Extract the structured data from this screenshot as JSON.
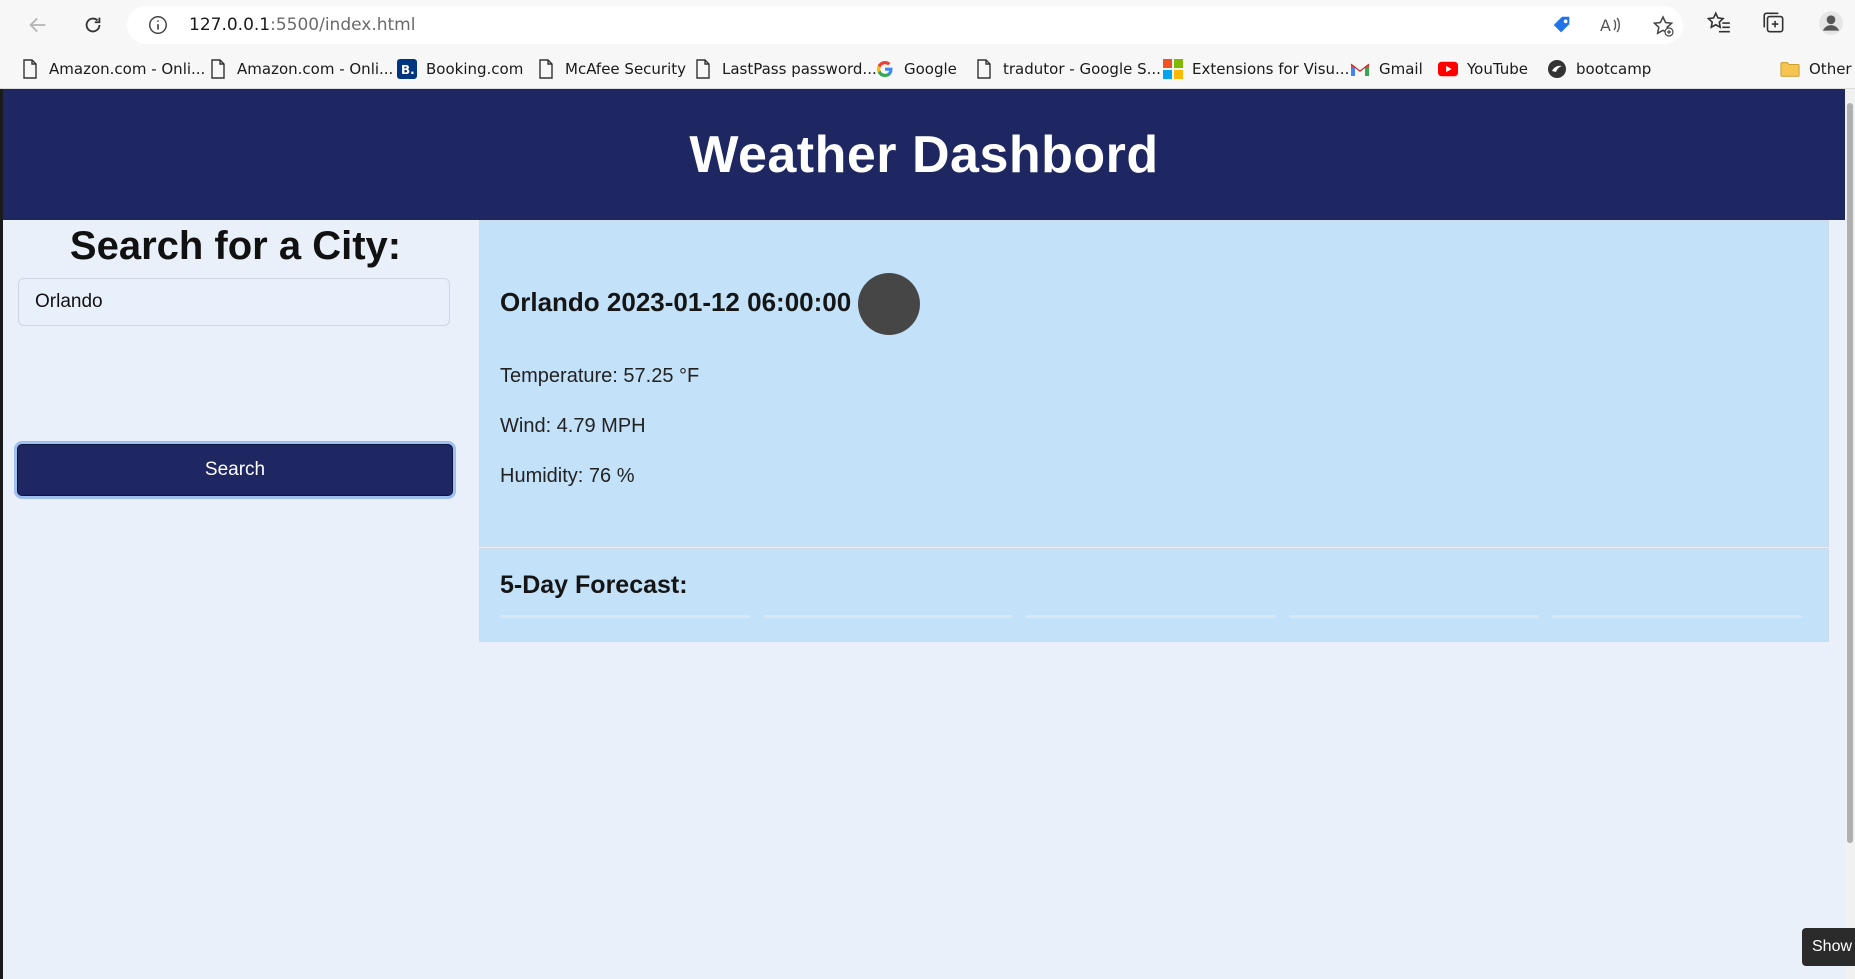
{
  "browser": {
    "url_host": "127.0.0.1",
    "url_rest": ":5500/index.html",
    "bookmarks": [
      {
        "label": "Amazon.com - Onli...",
        "icon": "page-icon"
      },
      {
        "label": "Amazon.com - Onli...",
        "icon": "page-icon"
      },
      {
        "label": "Booking.com",
        "icon": "booking-icon"
      },
      {
        "label": "McAfee Security",
        "icon": "page-icon"
      },
      {
        "label": "LastPass password...",
        "icon": "page-icon"
      },
      {
        "label": "Google",
        "icon": "google-icon"
      },
      {
        "label": "tradutor - Google S...",
        "icon": "page-icon"
      },
      {
        "label": "Extensions for Visu...",
        "icon": "microsoft-icon"
      },
      {
        "label": "Gmail",
        "icon": "gmail-icon"
      },
      {
        "label": "YouTube",
        "icon": "youtube-icon"
      },
      {
        "label": "bootcamp",
        "icon": "bootcamp-icon"
      },
      {
        "label": "Other",
        "icon": "folder-icon"
      }
    ]
  },
  "header": {
    "title": "Weather Dashbord"
  },
  "search": {
    "heading": "Search for a City:",
    "value": "Orlando",
    "button_label": "Search"
  },
  "current": {
    "title": "Orlando 2023-01-12 06:00:00",
    "temperature": "Temperature: 57.25 °F",
    "wind": "Wind: 4.79 MPH",
    "humidity": "Humidity: 76 %"
  },
  "forecast": {
    "heading": "5-Day Forecast:"
  },
  "tooltip": {
    "label": "Show"
  },
  "colors": {
    "header_bg": "#1e2762",
    "panel_bg": "#c3e1f8",
    "page_bg": "#e9f0f9"
  }
}
